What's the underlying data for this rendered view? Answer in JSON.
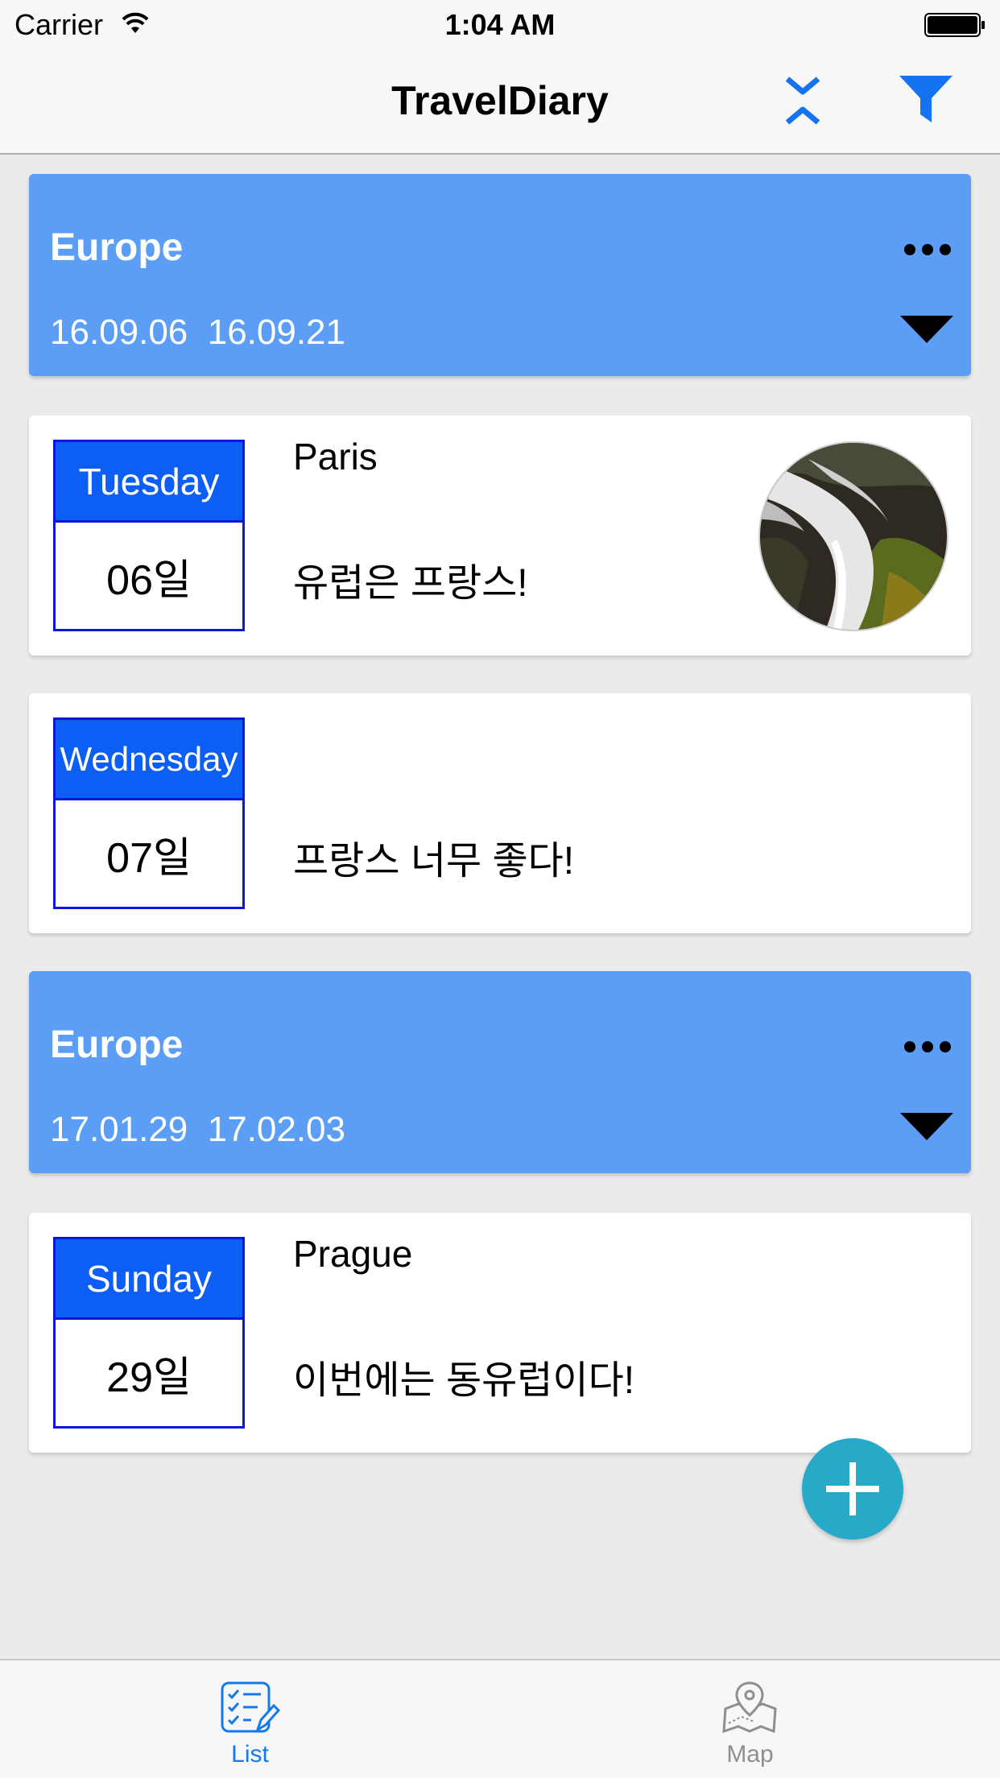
{
  "status_bar": {
    "carrier": "Carrier",
    "time": "1:04 AM"
  },
  "nav": {
    "title": "TravelDiary"
  },
  "trips": [
    {
      "title": "Europe",
      "dates": "16.09.06  16.09.21",
      "days": [
        {
          "weekday": "Tuesday",
          "day": "06일",
          "place": "Paris",
          "note": "유럽은 프랑스!",
          "has_photo": true
        },
        {
          "weekday": "Wednesday",
          "day": "07일",
          "place": "",
          "note": "프랑스 너무 좋다!",
          "has_photo": false
        }
      ]
    },
    {
      "title": "Europe",
      "dates": "17.01.29  17.02.03",
      "days": [
        {
          "weekday": "Sunday",
          "day": "29일",
          "place": "Prague",
          "note": "이번에는 동유럽이다!",
          "has_photo": false
        }
      ]
    }
  ],
  "tabs": [
    {
      "label": "List",
      "icon": "checklist-icon",
      "selected": true
    },
    {
      "label": "Map",
      "icon": "map-pin-icon",
      "selected": false
    }
  ],
  "colors": {
    "accent": "#1478f0",
    "trip_header": "#5c9ef5",
    "weekday_bg": "#0d5ef5",
    "date_border": "#0c17d9",
    "fab": "#27a9c8"
  }
}
